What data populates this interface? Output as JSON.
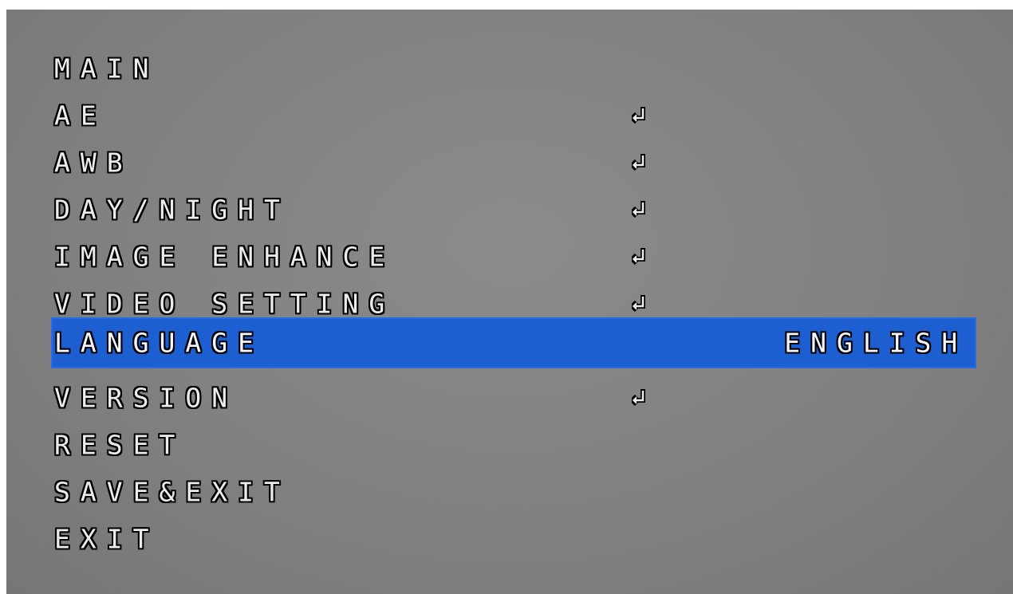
{
  "menu": {
    "title": "MAIN",
    "items": [
      {
        "label": "AE",
        "value": "",
        "submenu": true
      },
      {
        "label": "AWB",
        "value": "",
        "submenu": true
      },
      {
        "label": "DAY/NIGHT",
        "value": "",
        "submenu": true
      },
      {
        "label": "IMAGE ENHANCE",
        "value": "",
        "submenu": true
      },
      {
        "label": "VIDEO SETTING",
        "value": "",
        "submenu": true
      },
      {
        "label": "LANGUAGE",
        "value": "ENGLISH",
        "submenu": false,
        "selected": true
      },
      {
        "label": "VERSION",
        "value": "",
        "submenu": true
      },
      {
        "label": "RESET",
        "value": "",
        "submenu": false
      },
      {
        "label": "SAVE&EXIT",
        "value": "",
        "submenu": false
      },
      {
        "label": "EXIT",
        "value": "",
        "submenu": false
      }
    ],
    "enter_icon": "enter-return-icon",
    "left_arrow_icon": "left-arrow-icon",
    "right_arrow_icon": "right-arrow-icon"
  },
  "colors": {
    "background": "#818181",
    "selection": "#1d5fd1",
    "text": "#ececec",
    "outline": "#000000"
  }
}
